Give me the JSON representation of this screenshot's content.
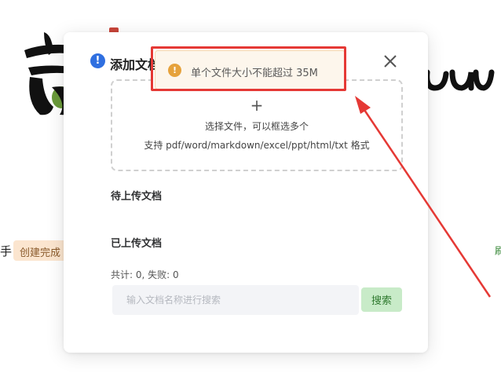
{
  "dialog": {
    "title": "添加文档",
    "upload": {
      "plus": "+",
      "hint": "选择文件，可以框选多个",
      "formats": "支持 pdf/word/markdown/excel/ppt/html/txt 格式"
    },
    "sections": {
      "pending": "待上传文档",
      "uploaded": "已上传文档"
    },
    "stats": "共计: 0, 失败: 0",
    "search": {
      "placeholder": "输入文档名称进行搜索",
      "value": "",
      "button_label": "搜索"
    }
  },
  "toast": {
    "icon": "warning-icon",
    "message": "单个文件大小不能超过 35M"
  },
  "background": {
    "left_char": "手",
    "status_badge": "创建完成",
    "right_char": "刷"
  },
  "colors": {
    "warning": "#e6a23c",
    "annotation_red": "#e53935",
    "primary_blue": "#2f6fe0",
    "button_green_bg": "#c8ebc8",
    "button_green_text": "#2f7a2f"
  }
}
